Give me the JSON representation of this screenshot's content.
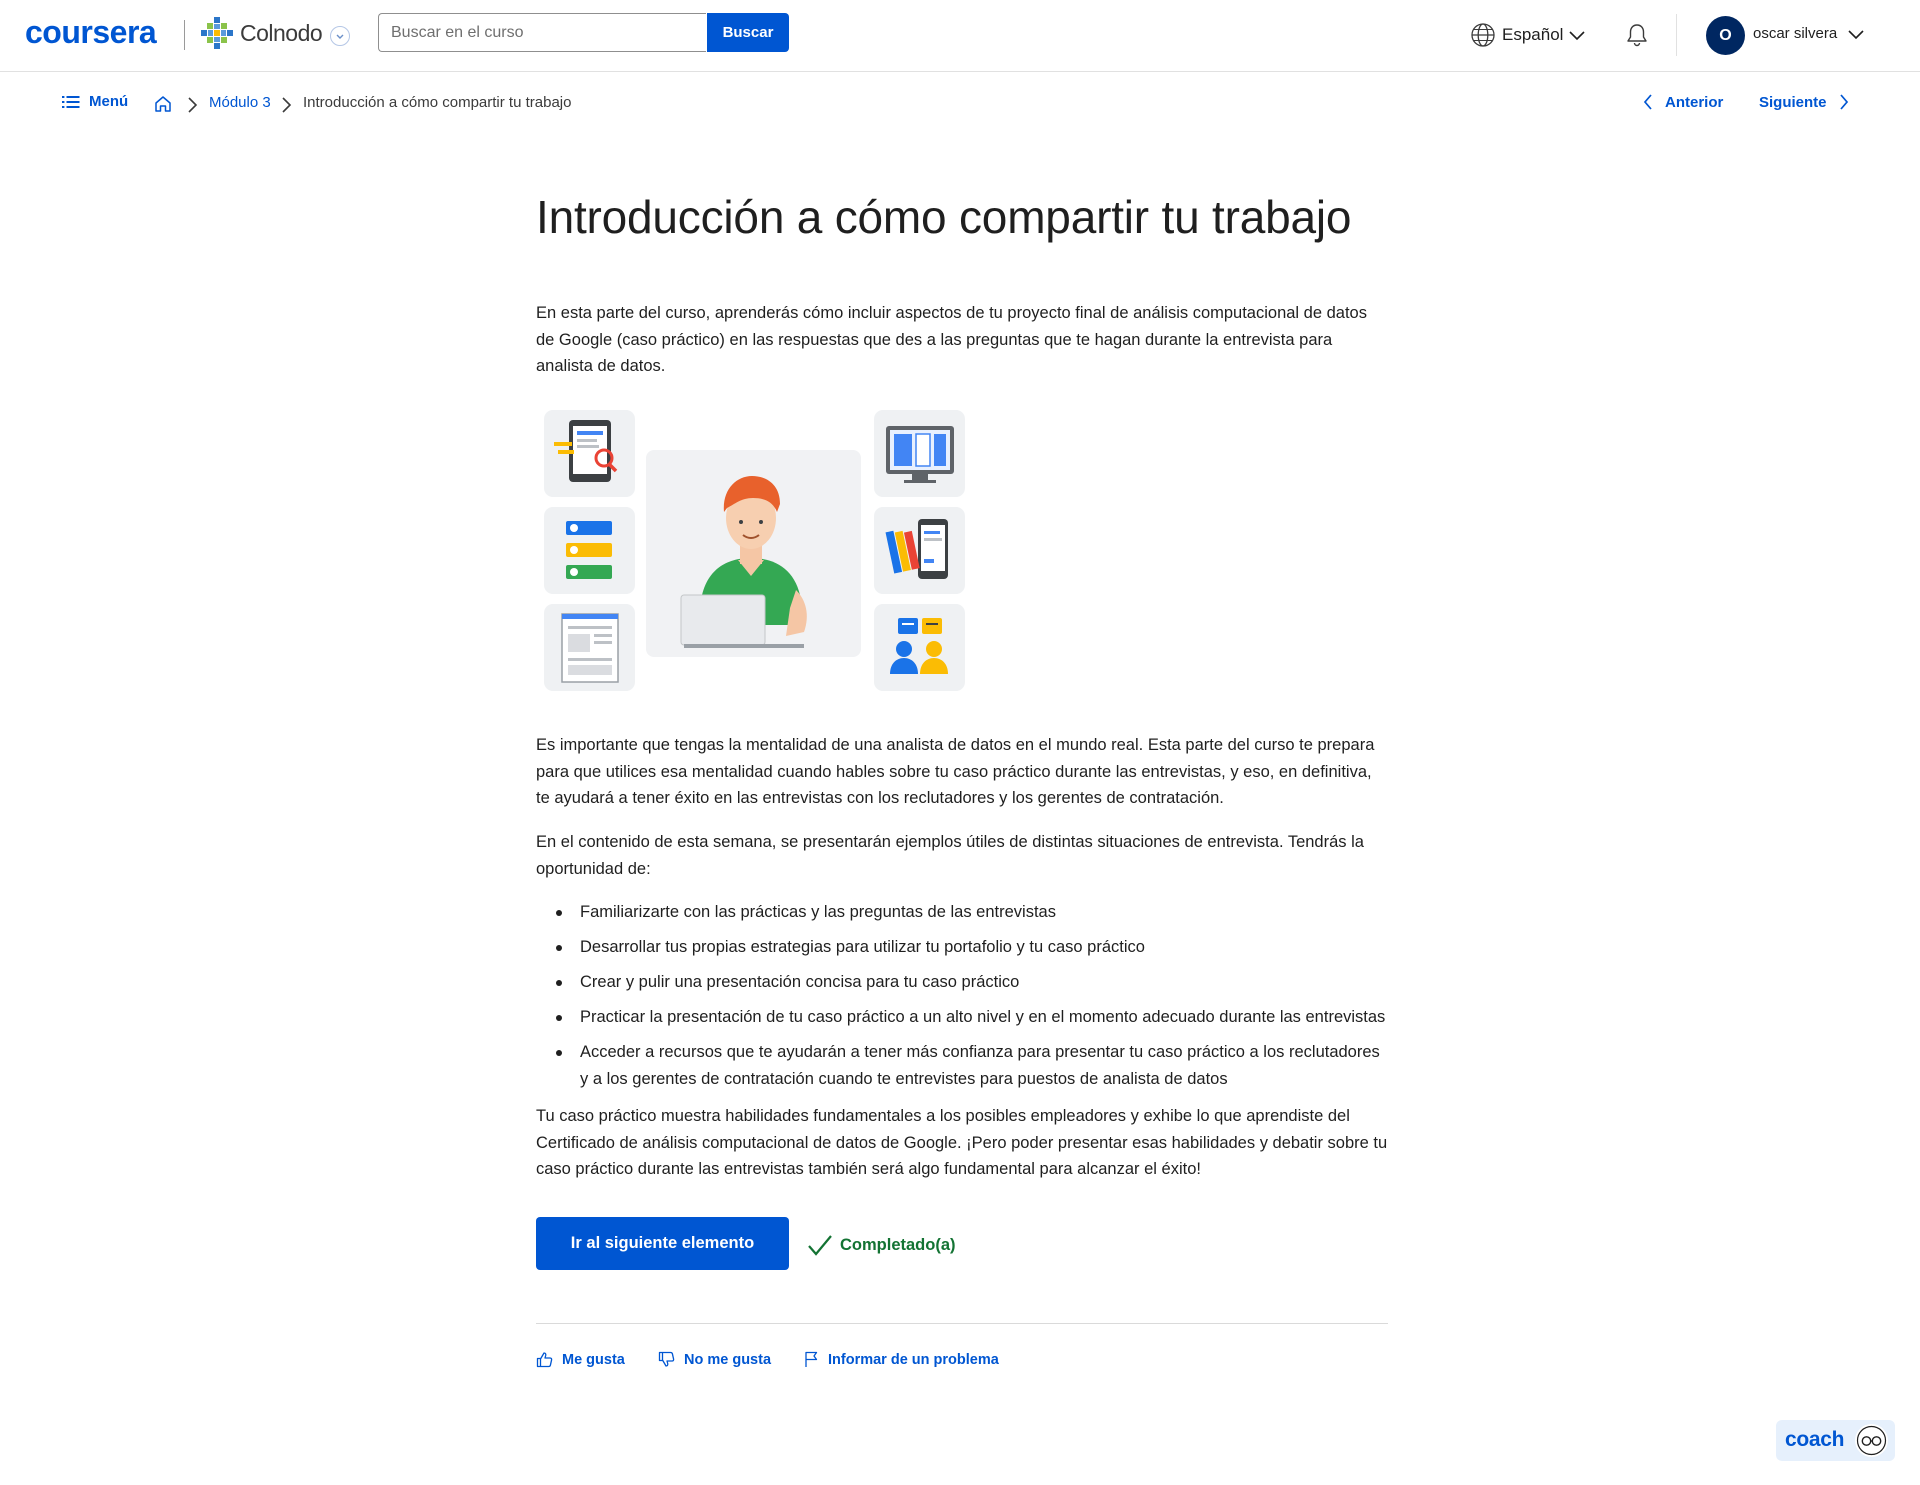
{
  "header": {
    "logo": "coursera",
    "partner_name": "Colnodo",
    "search": {
      "placeholder": "Buscar en el curso",
      "button_label": "Buscar"
    },
    "language": "Español",
    "user": {
      "initial": "O",
      "name": "oscar silvera"
    }
  },
  "breadcrumb": {
    "menu_label": "Menú",
    "module": "Módulo 3",
    "current": "Introducción a cómo compartir tu trabajo"
  },
  "pager": {
    "prev_label": "Anterior",
    "next_label": "Siguiente"
  },
  "article": {
    "title": "Introducción a cómo compartir tu trabajo",
    "intro": "En esta parte del curso, aprenderás cómo incluir aspectos de tu proyecto final de análisis computacional de datos de Google (caso práctico) en las respuestas que des a las preguntas que te hagan durante la entrevista para analista de datos.",
    "para2": "Es importante que tengas la mentalidad de una analista de datos en el mundo real. Esta parte del curso te prepara para que utilices esa mentalidad cuando hables sobre tu caso práctico durante las entrevistas, y eso, en definitiva, te ayudará a tener éxito en las entrevistas con los reclutadores y los gerentes de contratación.",
    "para3": "En el contenido de esta semana, se presentarán ejemplos útiles de distintas situaciones de entrevista. Tendrás la oportunidad de:",
    "bullets": [
      "Familiarizarte con las prácticas y las preguntas de las entrevistas",
      "Desarrollar tus propias estrategias para utilizar tu portafolio y tu caso práctico",
      "Crear y pulir una presentación concisa para tu caso práctico",
      "Practicar la presentación de tu caso práctico a un alto nivel y en el momento adecuado durante las entrevistas",
      "Acceder a recursos que te ayudarán a tener más confianza para presentar tu caso práctico a los reclutadores y a los gerentes de contratación cuando te entrevistes para puestos de analista de datos"
    ],
    "para4": "Tu caso práctico muestra habilidades fundamentales a los posibles empleadores y exhibe lo que aprendiste del Certificado de análisis computacional de datos de Google. ¡Pero poder presentar esas habilidades y debatir sobre tu caso práctico durante las entrevistas también será algo fundamental para alcanzar el éxito!"
  },
  "actions": {
    "next_item_label": "Ir al siguiente elemento",
    "completed_label": "Completado(a)"
  },
  "feedback": {
    "like": "Me gusta",
    "dislike": "No me gusta",
    "report": "Informar de un problema"
  },
  "coach": {
    "label": "coach"
  },
  "colors": {
    "brand_blue": "#0056d2",
    "success_green": "#137333",
    "avatar_navy": "#002761",
    "shirt_green": "#34a853",
    "hair_orange": "#e8612c",
    "accent_yellow": "#fbbc04"
  },
  "icons": [
    "hamburger-icon",
    "home-icon",
    "chevron-right-icon",
    "chevron-left-icon",
    "globe-icon",
    "bell-icon",
    "chevron-down-icon",
    "checkmark-icon",
    "thumbs-up-icon",
    "thumbs-down-icon",
    "flag-icon",
    "coach-glasses-icon"
  ]
}
